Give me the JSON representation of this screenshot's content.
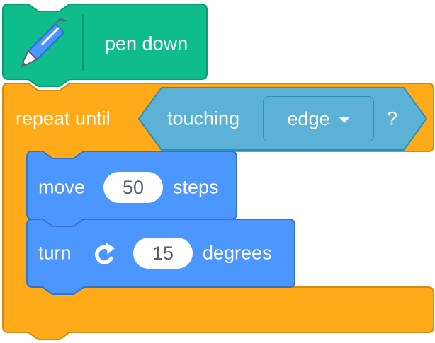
{
  "blocks": {
    "pen_down": {
      "label": "pen down",
      "icon": "pen-icon",
      "color": "#0fbd8c"
    },
    "repeat_until": {
      "label": "repeat until",
      "color": "#ffab19",
      "condition": {
        "label": "touching",
        "dropdown_value": "edge",
        "suffix": "?",
        "color": "#5cb1d6"
      }
    },
    "move": {
      "label": "move",
      "value": "50",
      "suffix": "steps",
      "color": "#4c97ff"
    },
    "turn": {
      "label": "turn",
      "icon": "rotate-clockwise-icon",
      "value": "15",
      "suffix": "degrees",
      "color": "#4c97ff"
    }
  }
}
